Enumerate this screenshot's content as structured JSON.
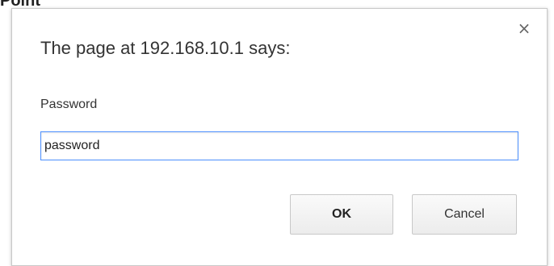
{
  "dialog": {
    "title": "The page at 192.168.10.1 says:",
    "close_glyph": "×",
    "close_icon": "close-icon",
    "field_label": "Password",
    "input_value": "password",
    "ok_label": "OK",
    "cancel_label": "Cancel"
  },
  "background": {
    "partial_text": "Point"
  },
  "colors": {
    "focus_border": "#4d90fe",
    "button_border": "#c8c8c8"
  }
}
